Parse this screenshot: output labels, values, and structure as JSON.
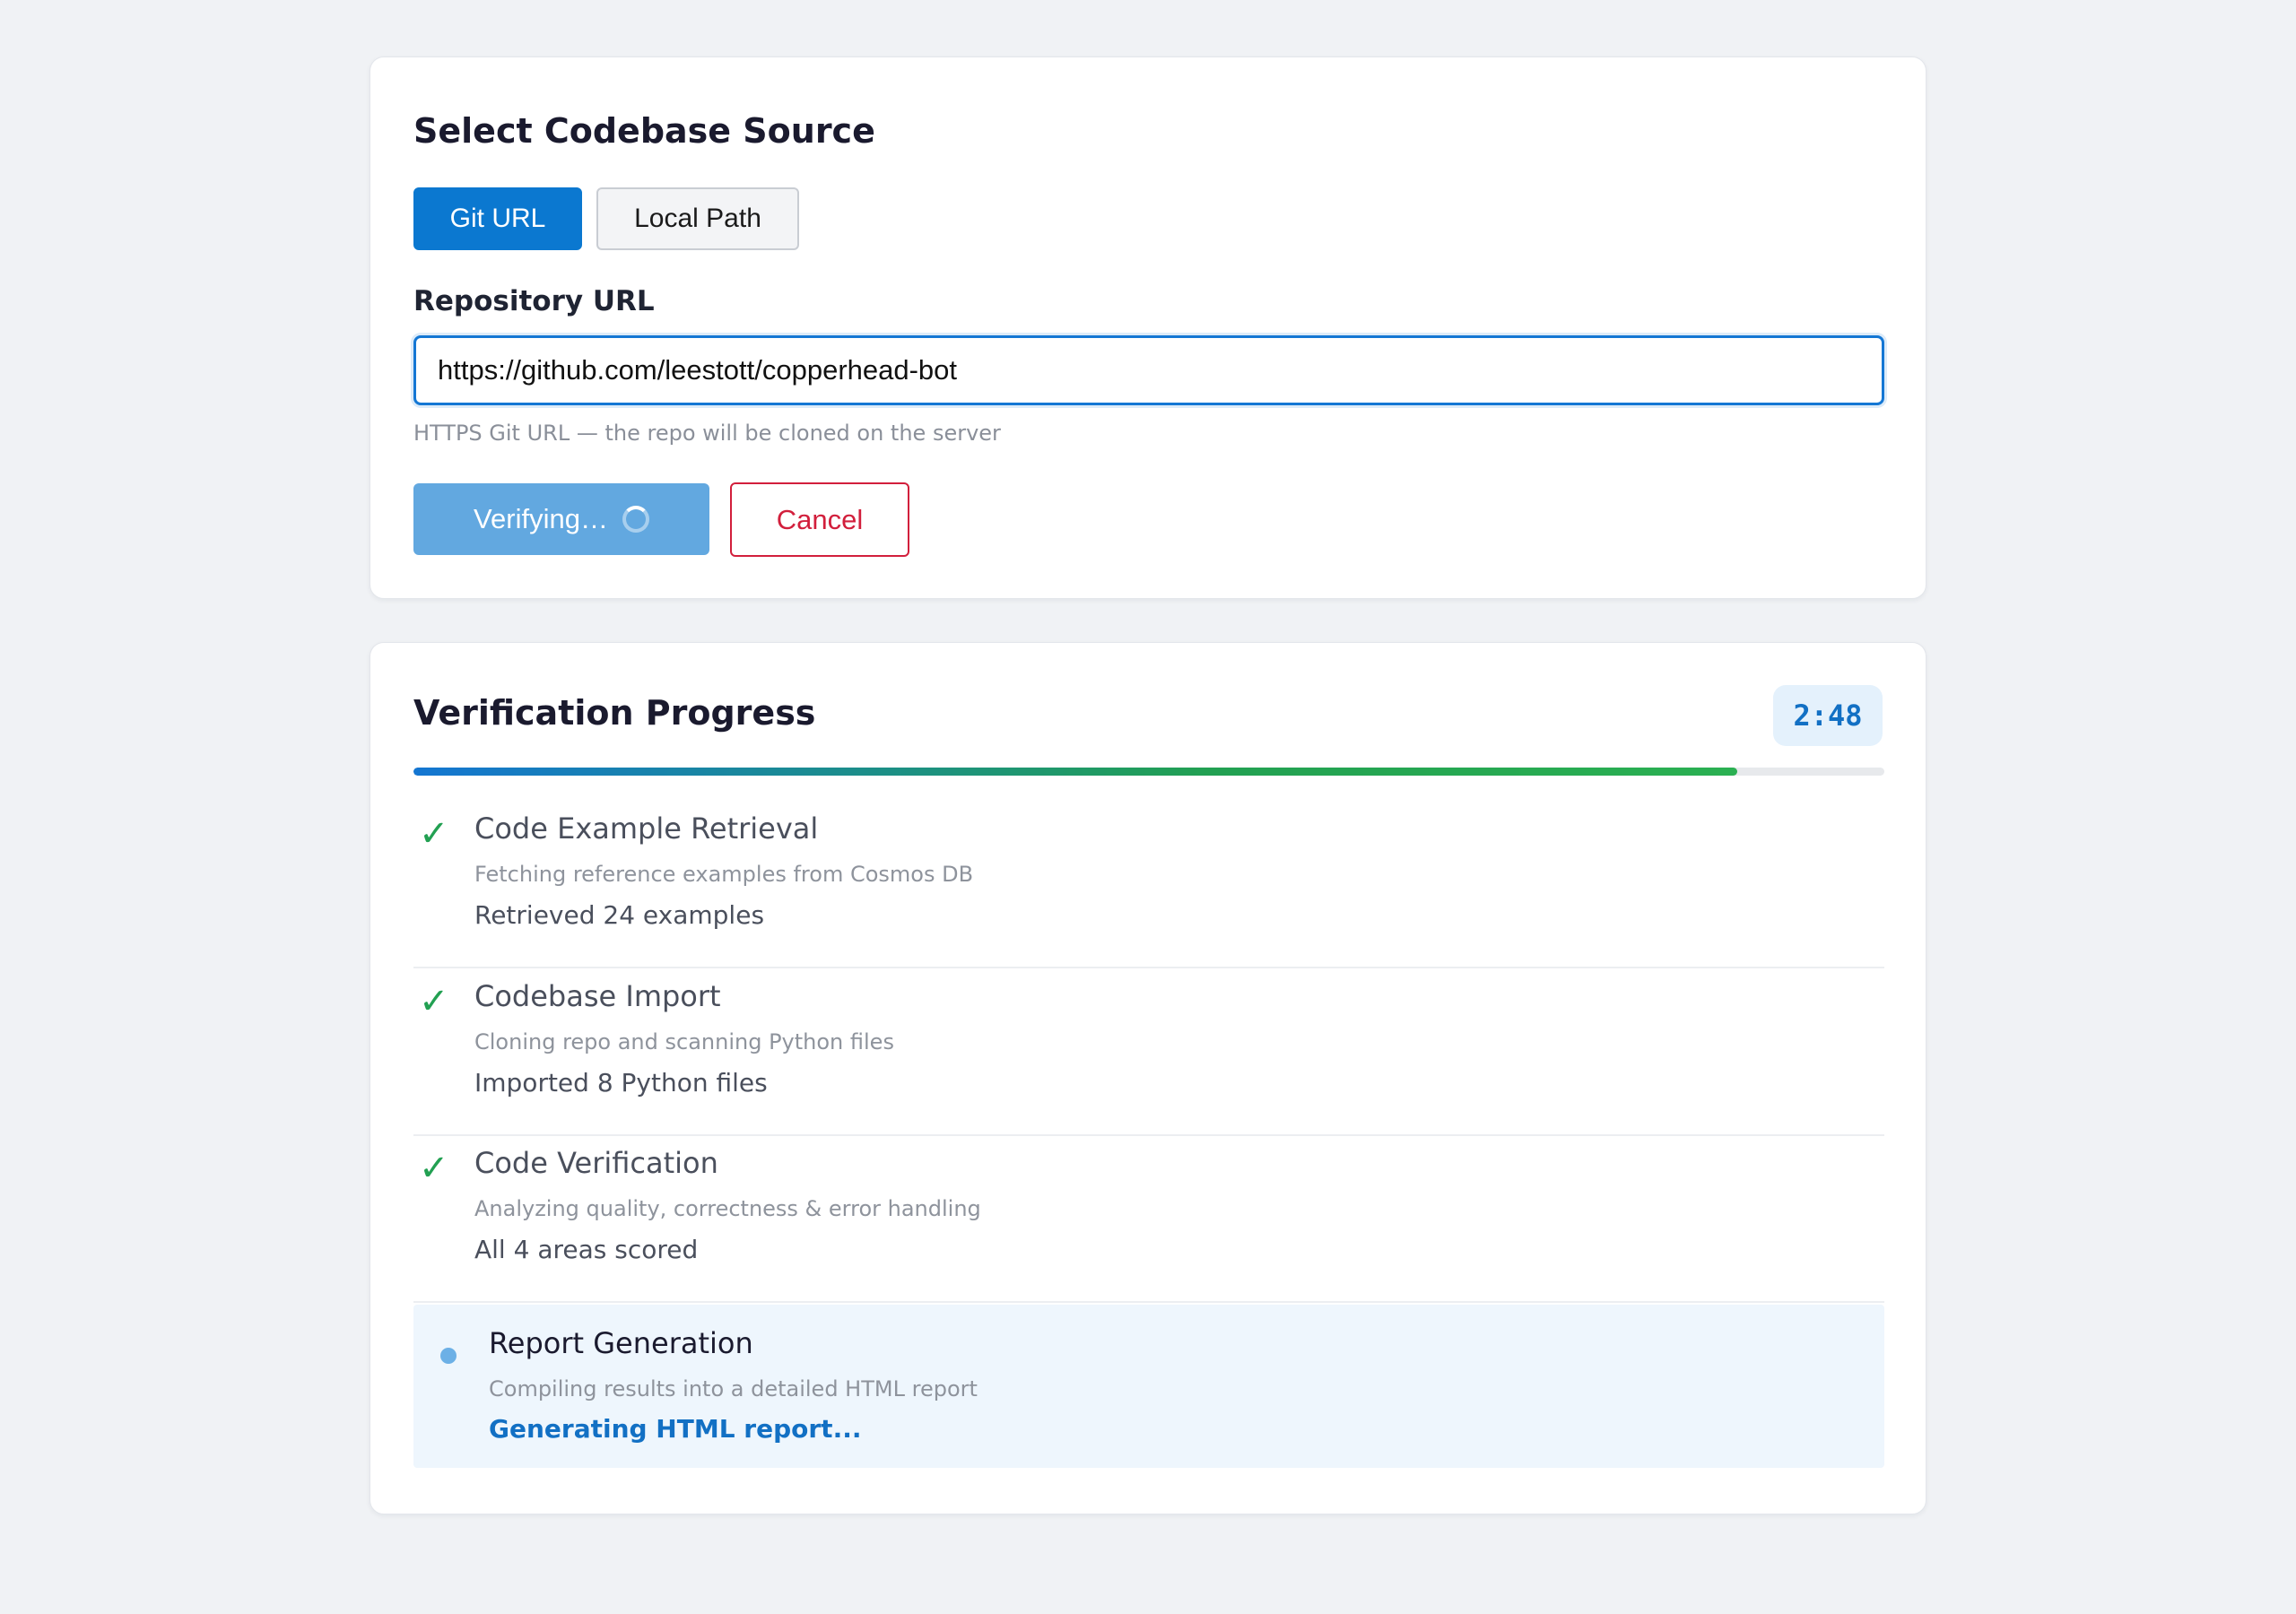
{
  "source": {
    "title": "Select Codebase Source",
    "tabs": [
      {
        "label": "Git URL",
        "selected": true
      },
      {
        "label": "Local Path",
        "selected": false
      }
    ],
    "field_label": "Repository URL",
    "url_value": "https://github.com/leestott/copperhead-bot",
    "hint": "HTTPS Git URL — the repo will be cloned on the server",
    "verify_label": "Verifying…",
    "cancel_label": "Cancel"
  },
  "progress": {
    "title": "Verification Progress",
    "timer": "2:48",
    "percent": 90,
    "steps": [
      {
        "title": "Code Example Retrieval",
        "description": "Fetching reference examples from Cosmos DB",
        "result": "Retrieved 24 examples",
        "status": "done"
      },
      {
        "title": "Codebase Import",
        "description": "Cloning repo and scanning Python files",
        "result": "Imported 8 Python files",
        "status": "done"
      },
      {
        "title": "Code Verification",
        "description": "Analyzing quality, correctness & error handling",
        "result": "All 4 areas scored",
        "status": "done"
      },
      {
        "title": "Report Generation",
        "description": "Compiling results into a detailed HTML report",
        "result": "Generating HTML report...",
        "status": "active"
      }
    ]
  },
  "colors": {
    "accent": "#0b78d0",
    "success": "#22a052",
    "danger": "#d21f3c",
    "background": "#f0f2f5"
  },
  "icons": {
    "done": "checkmark-icon",
    "active": "dot-icon",
    "loading": "spinner-icon"
  }
}
